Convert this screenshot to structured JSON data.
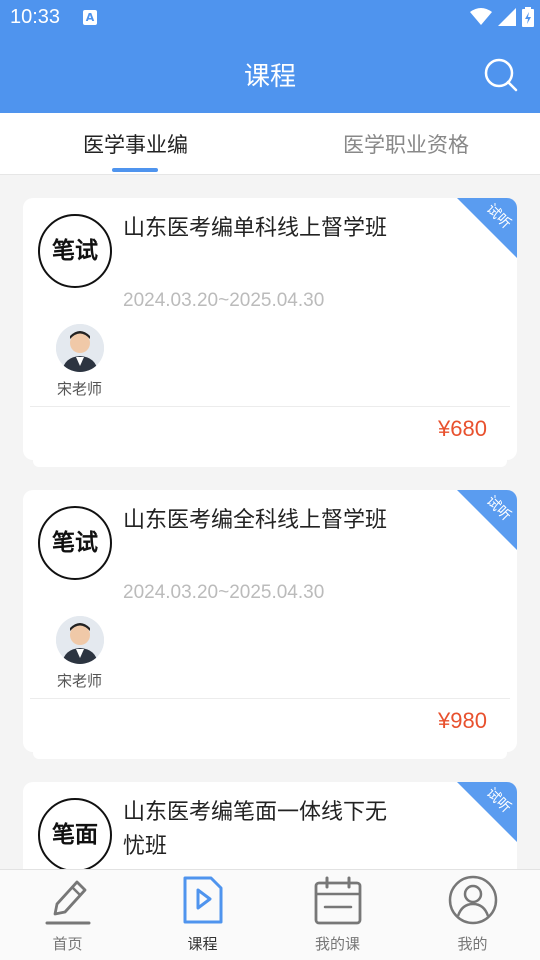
{
  "status_bar": {
    "time": "10:33",
    "app_badge": "A"
  },
  "header": {
    "title": "课程"
  },
  "tabs": [
    {
      "label": "医学事业编",
      "active": true
    },
    {
      "label": "医学职业资格",
      "active": false
    }
  ],
  "courses": [
    {
      "badge": "笔试",
      "title": "山东医考编单科线上督学班",
      "date": "2024.03.20~2025.04.30",
      "teacher": "宋老师",
      "price": "¥680",
      "ribbon": "试听"
    },
    {
      "badge": "笔试",
      "title": "山东医考编全科线上督学班",
      "date": "2024.03.20~2025.04.30",
      "teacher": "宋老师",
      "price": "¥980",
      "ribbon": "试听"
    },
    {
      "badge": "笔面",
      "title": "山东医考编笔面一体线下无忧班",
      "ribbon": "试听"
    }
  ],
  "bottom_nav": [
    {
      "label": "首页",
      "icon": "pen-icon",
      "active": false
    },
    {
      "label": "课程",
      "icon": "play-document-icon",
      "active": true
    },
    {
      "label": "我的课",
      "icon": "calendar-icon",
      "active": false
    },
    {
      "label": "我的",
      "icon": "user-icon",
      "active": false
    }
  ],
  "colors": {
    "brand": "#4f94ee",
    "price": "#e8512e"
  }
}
